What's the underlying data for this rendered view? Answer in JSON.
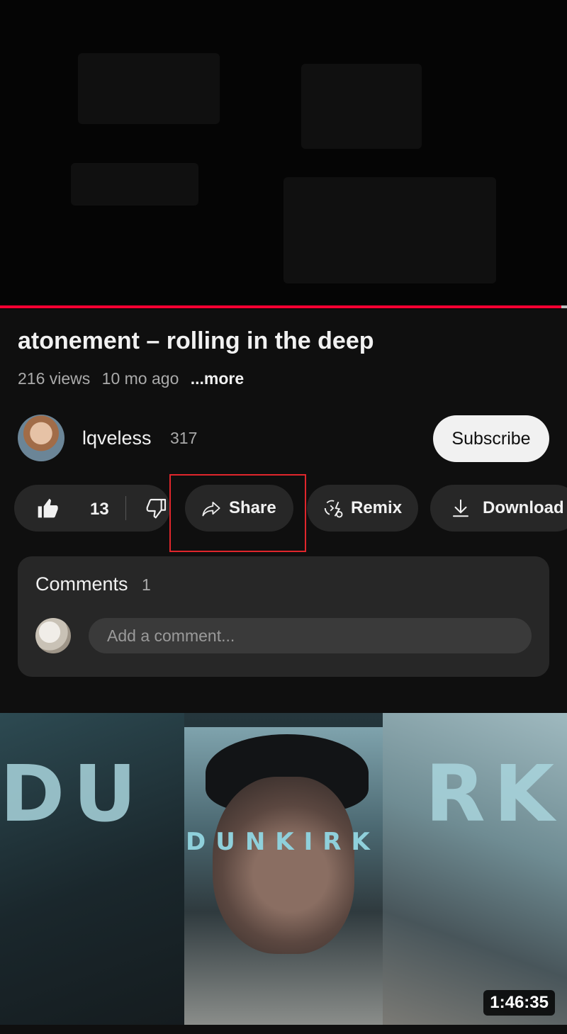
{
  "video": {
    "title": "atonement – rolling in the deep",
    "views": "216 views",
    "age": "10 mo ago",
    "more_label": "...more",
    "progress": 0.99
  },
  "channel": {
    "name": "lqveless",
    "subscriber_count": "317",
    "subscribe_label": "Subscribe"
  },
  "actions": {
    "like_count": "13",
    "share_label": "Share",
    "remix_label": "Remix",
    "download_label": "Download"
  },
  "comments": {
    "title": "Comments",
    "count": "1",
    "placeholder": "Add a comment..."
  },
  "next_video": {
    "left_text": "DU",
    "mid_text": "DUNKIRK",
    "right_text": "RK",
    "duration": "1:46:35"
  },
  "colors": {
    "background": "#0f0f0f",
    "pill": "#272727",
    "highlight_box": "#e0262c"
  }
}
